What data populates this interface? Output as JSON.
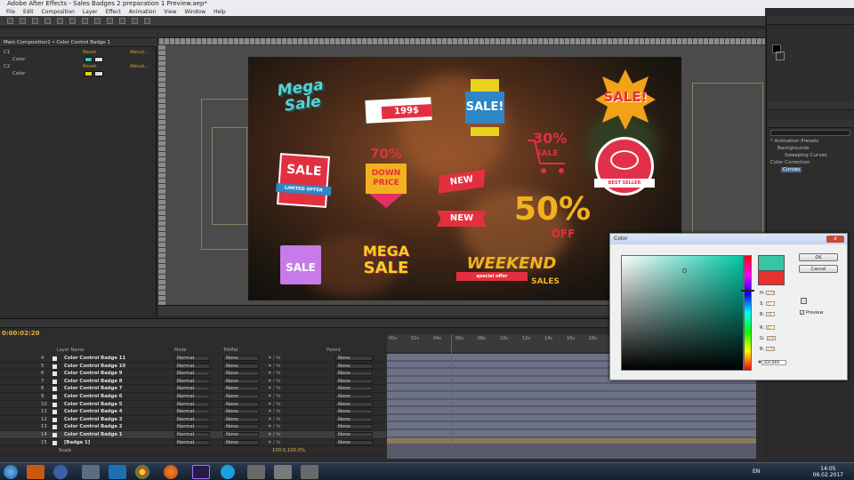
{
  "window": {
    "title": "Adobe After Effects - Sales Badges 2 preparation 1 Preview.aep*"
  },
  "menu": [
    "File",
    "Edit",
    "Composition",
    "Layer",
    "Effect",
    "Animation",
    "View",
    "Window",
    "Help"
  ],
  "effects_panel": {
    "title": "Main Composition1 • Color Control Badge 1",
    "effects": [
      {
        "label": "C1",
        "reset": "Reset",
        "about": "About..."
      },
      {
        "label": "Color",
        "swatch": "#35c7a5"
      },
      {
        "label": "C2",
        "reset": "Reset",
        "about": "About..."
      },
      {
        "label": "Color",
        "swatch": "#e8d21e"
      }
    ]
  },
  "badges": {
    "mega_sale_script": "Mega Sale",
    "price_tag": "199$",
    "sale_box": "SALE!",
    "sale_starburst": "SALE!",
    "sale_limited": "SALE",
    "limited_offer": "LIMITED OFFER",
    "pct_70": "70%",
    "down_price": "DOWN PRICE",
    "cart_30": "30%",
    "cart_sale": "SALE",
    "best_seller": "BEST SELLER",
    "new_1": "NEW",
    "new_2": "NEW",
    "off_50": "50%",
    "off_word": "OFF",
    "bag_sale": "SALE",
    "mega_sale_block_1": "MEGA",
    "mega_sale_block_2": "SALE",
    "weekend": "WEEKEND",
    "weekend_special": "special offer",
    "weekend_sales": "SALES"
  },
  "effects_presets": {
    "items": [
      "* Animation Presets",
      "Backgrounds",
      "Sweeping Curves",
      "Color Correction",
      "Curves"
    ]
  },
  "timeline": {
    "timecode": "0:00:02:20",
    "columns": [
      "Layer Name",
      "Mode",
      "TrkMat",
      "Parent"
    ],
    "layers": [
      {
        "num": "4",
        "name": "Color Control Badge 11",
        "mode": "Normal",
        "trk": "None",
        "parent": "None"
      },
      {
        "num": "5",
        "name": "Color Control Badge 10",
        "mode": "Normal",
        "trk": "None",
        "parent": "None"
      },
      {
        "num": "6",
        "name": "Color Control Badge 9",
        "mode": "Normal",
        "trk": "None",
        "parent": "None"
      },
      {
        "num": "7",
        "name": "Color Control Badge 8",
        "mode": "Normal",
        "trk": "None",
        "parent": "None"
      },
      {
        "num": "8",
        "name": "Color Control Badge 7",
        "mode": "Normal",
        "trk": "None",
        "parent": "None"
      },
      {
        "num": "9",
        "name": "Color Control Badge 6",
        "mode": "Normal",
        "trk": "None",
        "parent": "None"
      },
      {
        "num": "10",
        "name": "Color Control Badge 5",
        "mode": "Normal",
        "trk": "None",
        "parent": "None"
      },
      {
        "num": "11",
        "name": "Color Control Badge 4",
        "mode": "Normal",
        "trk": "None",
        "parent": "None"
      },
      {
        "num": "12",
        "name": "Color Control Badge 3",
        "mode": "Normal",
        "trk": "None",
        "parent": "None"
      },
      {
        "num": "13",
        "name": "Color Control Badge 2",
        "mode": "Normal",
        "trk": "None",
        "parent": "None"
      },
      {
        "num": "14",
        "name": "Color Control Badge 1",
        "mode": "Normal",
        "trk": "None",
        "parent": "None"
      },
      {
        "num": "15",
        "name": "[Badge 1]",
        "mode": "Normal",
        "trk": "None",
        "parent": "None"
      }
    ],
    "sub_row": {
      "label": "Scale",
      "value": "100.0,100.0%"
    },
    "ruler_ticks": [
      "00s",
      "02s",
      "04s",
      "06s",
      "08s",
      "10s",
      "12s",
      "14s",
      "16s",
      "18s"
    ]
  },
  "color_dialog": {
    "title": "Color",
    "close": "x",
    "ok": "OK",
    "cancel": "Cancel",
    "preview_label": "Preview",
    "fields": [
      {
        "label": "H:",
        "value": "170"
      },
      {
        "label": "S:",
        "value": "77"
      },
      {
        "label": "B:",
        "value": "78"
      },
      {
        "label": "R:",
        "value": "45"
      },
      {
        "label": "G:",
        "value": "200"
      },
      {
        "label": "B:",
        "value": "176"
      }
    ],
    "hex": "2DC8B0",
    "new_color": "#35c7a5",
    "old_color": "#e83030"
  },
  "taskbar": {
    "language": "EN",
    "time": "14:05",
    "date": "06.02.2017"
  }
}
